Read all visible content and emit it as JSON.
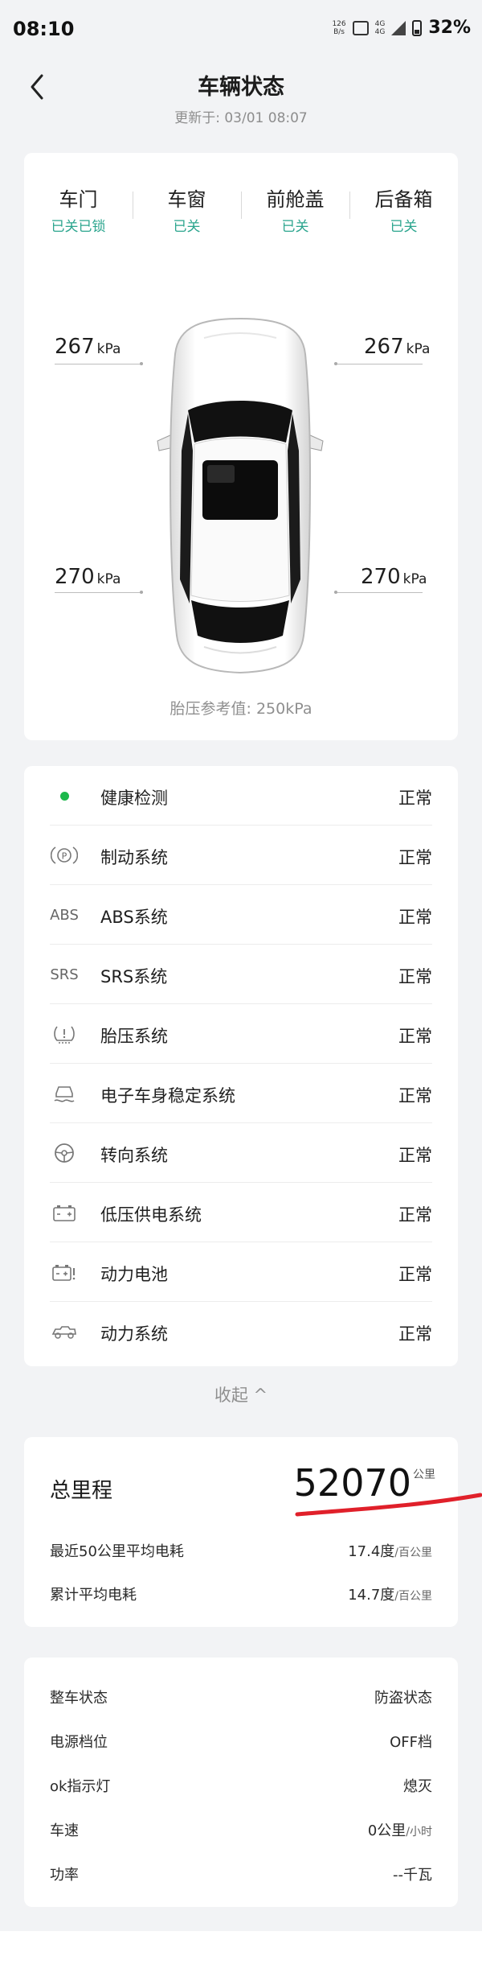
{
  "status_bar": {
    "time": "08:10",
    "speed_num": "126",
    "speed_unit": "B/s",
    "battery": "32%",
    "hd_label": "HD",
    "net_label_1": "4G",
    "net_label_2": "4G"
  },
  "header": {
    "title": "车辆状态",
    "updated": "更新于: 03/01 08:07"
  },
  "doors": [
    {
      "label": "车门",
      "status": "已关已锁"
    },
    {
      "label": "车窗",
      "status": "已关"
    },
    {
      "label": "前舱盖",
      "status": "已关"
    },
    {
      "label": "后备箱",
      "status": "已关"
    }
  ],
  "tires": {
    "front_left": "267",
    "front_right": "267",
    "rear_left": "270",
    "rear_right": "270",
    "unit": "kPa"
  },
  "pressure_ref": "胎压参考值: 250kPa",
  "systems": [
    {
      "icon": "health-dot-icon",
      "name": "健康检测",
      "status": "正常"
    },
    {
      "icon": "parking-brake-icon",
      "name": "制动系统",
      "status": "正常",
      "icon_text": "(P)"
    },
    {
      "icon": "abs-icon",
      "name": "ABS系统",
      "status": "正常",
      "icon_text": "ABS"
    },
    {
      "icon": "srs-icon",
      "name": "SRS系统",
      "status": "正常",
      "icon_text": "SRS"
    },
    {
      "icon": "tire-pressure-icon",
      "name": "胎压系统",
      "status": "正常"
    },
    {
      "icon": "stability-control-icon",
      "name": "电子车身稳定系统",
      "status": "正常"
    },
    {
      "icon": "steering-wheel-icon",
      "name": "转向系统",
      "status": "正常"
    },
    {
      "icon": "low-voltage-battery-icon",
      "name": "低压供电系统",
      "status": "正常"
    },
    {
      "icon": "power-battery-icon",
      "name": "动力电池",
      "status": "正常"
    },
    {
      "icon": "powertrain-icon",
      "name": "动力系统",
      "status": "正常"
    }
  ],
  "collapse_label": "收起 ^",
  "mileage": {
    "label": "总里程",
    "value": "52070",
    "unit": "公里",
    "recent_label": "最近50公里平均电耗",
    "recent_value": "17.4度",
    "recent_unit": "/百公里",
    "total_label": "累计平均电耗",
    "total_value": "14.7度",
    "total_unit": "/百公里"
  },
  "vehicle": {
    "state_label": "整车状态",
    "state_value": "防盗状态",
    "power_label": "电源档位",
    "power_value": "OFF档",
    "ok_label": "ok指示灯",
    "ok_value": "熄灭",
    "speed_label": "车速",
    "speed_value": "0公里",
    "speed_unit": "/小时",
    "power2_label": "功率",
    "power2_value": "--千瓦"
  },
  "colors": {
    "accent_green": "#2ba58e",
    "health_green": "#1cb84b",
    "annotation_red": "#e0202a"
  }
}
